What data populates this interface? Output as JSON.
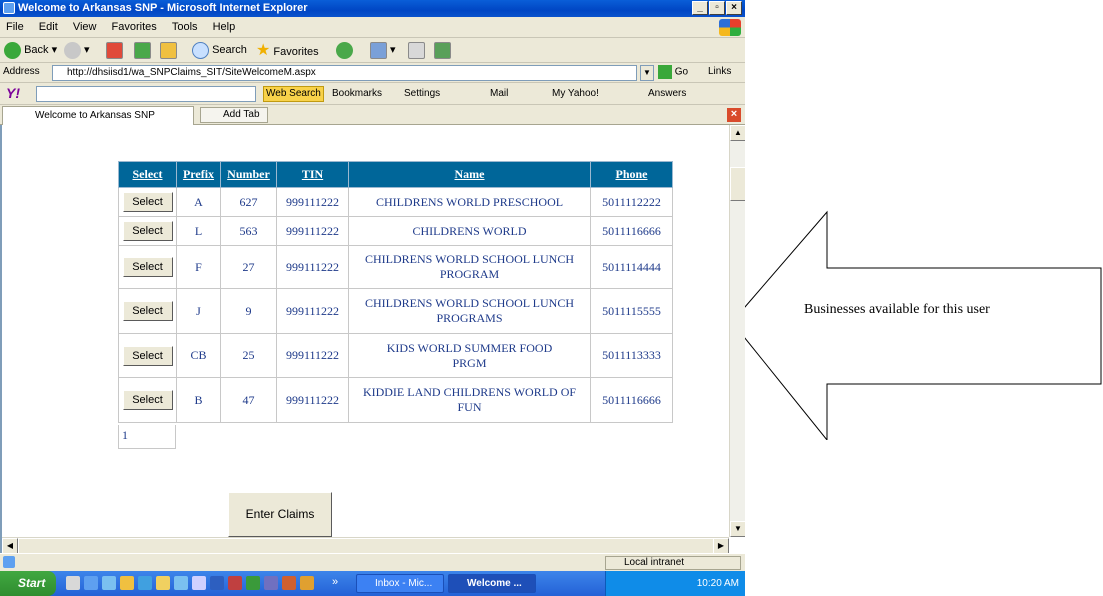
{
  "window": {
    "title": "Welcome to Arkansas SNP - Microsoft Internet Explorer",
    "buttons": {
      "minimize": "_",
      "maximize": "▫",
      "close": "×"
    }
  },
  "menu": [
    "File",
    "Edit",
    "View",
    "Favorites",
    "Tools",
    "Help"
  ],
  "toolbar": {
    "back": "Back",
    "search": "Search",
    "favorites": "Favorites"
  },
  "address": {
    "label": "Address",
    "url": "http://dhsiisd1/wa_SNPClaims_SIT/SiteWelcomeM.aspx",
    "go": "Go",
    "links": "Links"
  },
  "yahoo": {
    "logo": "Y!",
    "web_search": "Web Search",
    "bookmarks": "Bookmarks",
    "settings": "Settings",
    "mail": "Mail",
    "my_yahoo": "My Yahoo!",
    "answers": "Answers"
  },
  "tabs": {
    "active_tab": "Welcome to Arkansas SNP",
    "add_tab": "Add Tab"
  },
  "table": {
    "headers": [
      "Select",
      "Prefix",
      "Number",
      "TIN",
      "Name",
      "Phone"
    ],
    "select_label": "Select",
    "rows": [
      {
        "prefix": "A",
        "number": "627",
        "tin": "999111222",
        "name": "CHILDRENS WORLD PRESCHOOL",
        "phone": "5011112222"
      },
      {
        "prefix": "L",
        "number": "563",
        "tin": "999111222",
        "name": "CHILDRENS WORLD",
        "phone": "5011116666"
      },
      {
        "prefix": "F",
        "number": "27",
        "tin": "999111222",
        "name": "CHILDRENS WORLD SCHOOL LUNCH PROGRAM",
        "phone": "5011114444"
      },
      {
        "prefix": "J",
        "number": "9",
        "tin": "999111222",
        "name": "CHILDRENS WORLD SCHOOL LUNCH PROGRAMS",
        "phone": "5011115555"
      },
      {
        "prefix": "CB",
        "number": "25",
        "tin": "999111222",
        "name": "KIDS WORLD SUMMER FOOD PRGM",
        "phone": "5011113333"
      },
      {
        "prefix": "B",
        "number": "47",
        "tin": "999111222",
        "name": "KIDDIE LAND CHILDRENS WORLD OF FUN",
        "phone": "5011116666"
      }
    ],
    "pager": "1"
  },
  "enter_claims": "Enter Claims",
  "status": {
    "zone": "Local intranet"
  },
  "taskbar": {
    "start": "Start",
    "tasks": [
      "Inbox - Mic...",
      "Welcome ..."
    ],
    "clock": "10:20 AM"
  },
  "callout": "Businesses available for this user",
  "colors": {
    "header_bg": "#006699",
    "cell_text": "#1e3a8a"
  }
}
